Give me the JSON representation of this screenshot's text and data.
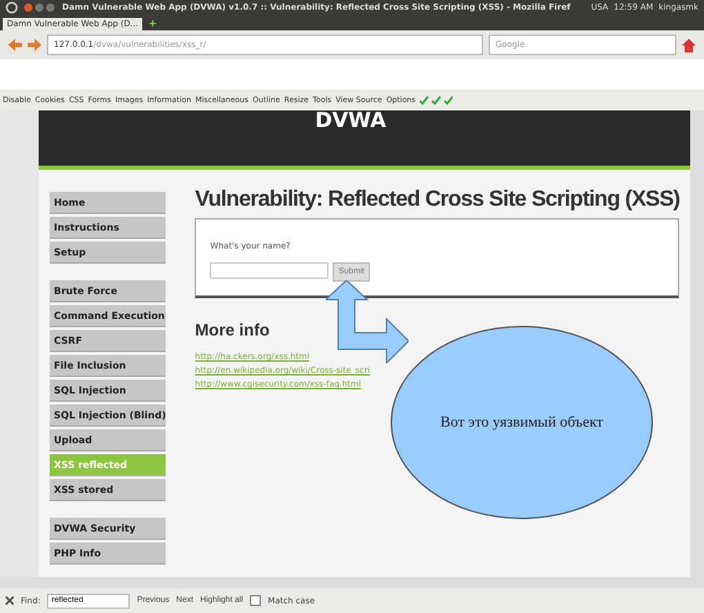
{
  "system_bar": {
    "title": "Damn Vulnerable Web App (DVWA) v1.0.7 :: Vulnerability: Reflected Cross Site Scripting (XSS) - Mozilla Firef",
    "keyboard": "USA",
    "time": "12:59 AM",
    "user": "kingasmk"
  },
  "tabs": [
    {
      "label": "Damn Vulnerable Web App (D...",
      "selected": true
    }
  ],
  "new_tab": "+",
  "address_bar": {
    "host": "127.0.0.1",
    "path": "/dvwa/vulnerabilities/xss_r/"
  },
  "search": {
    "placeholder": "Google"
  },
  "dev_toolbar": [
    "Disable",
    "Cookies",
    "CSS",
    "Forms",
    "Images",
    "Information",
    "Miscellaneous",
    "Outline",
    "Resize",
    "Tools",
    "View Source",
    "Options"
  ],
  "logo": "DVWA",
  "sidebar": {
    "groups": [
      [
        {
          "label": "Home",
          "selected": false
        },
        {
          "label": "Instructions",
          "selected": false
        },
        {
          "label": "Setup",
          "selected": false
        }
      ],
      [
        {
          "label": "Brute Force",
          "selected": false
        },
        {
          "label": "Command Execution",
          "selected": false
        },
        {
          "label": "CSRF",
          "selected": false
        },
        {
          "label": "File Inclusion",
          "selected": false
        },
        {
          "label": "SQL Injection",
          "selected": false
        },
        {
          "label": "SQL Injection (Blind)",
          "selected": false
        },
        {
          "label": "Upload",
          "selected": false
        },
        {
          "label": "XSS reflected",
          "selected": true
        },
        {
          "label": "XSS stored",
          "selected": false
        }
      ],
      [
        {
          "label": "DVWA Security",
          "selected": false
        },
        {
          "label": "PHP Info",
          "selected": false
        }
      ]
    ]
  },
  "heading": "Vulnerability: Reflected Cross Site Scripting (XSS)",
  "form": {
    "label": "What's your name?",
    "button": "Submit"
  },
  "more_info": {
    "title": "More info",
    "links": [
      "http://ha.ckers.org/xss.html",
      "http://en.wikipedia.org/wiki/Cross-site_scri",
      "http://www.cgisecurity.com/xss-faq.html"
    ]
  },
  "callout": "Вот это уязвимый объект",
  "find_bar": {
    "label": "Find:",
    "value": "reflected",
    "previous": "Previous",
    "next": "Next",
    "highlight": "Highlight all",
    "match_case": {
      "label": "Match case",
      "checked": false
    }
  }
}
